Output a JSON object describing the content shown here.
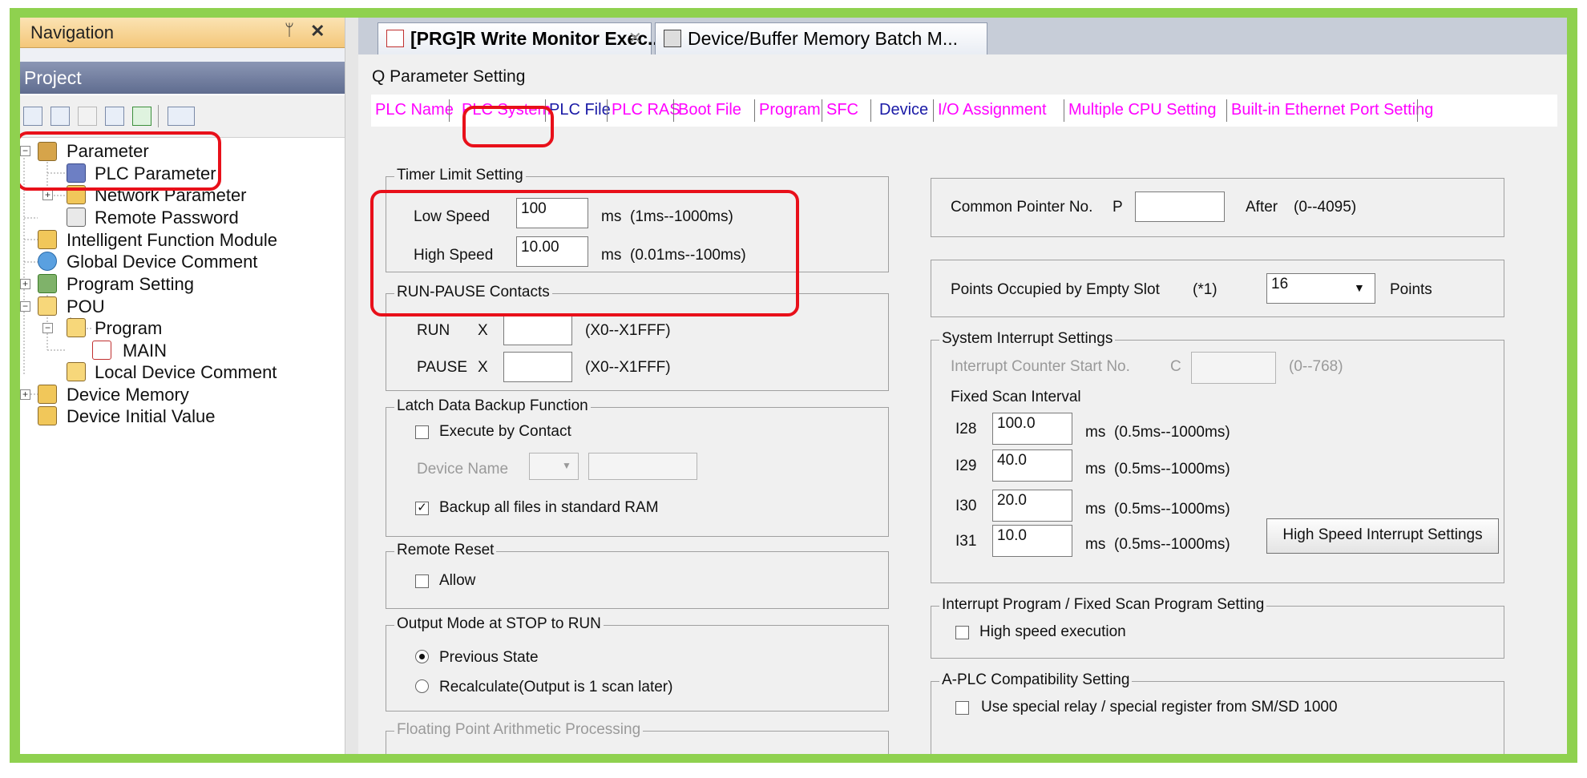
{
  "nav": {
    "title": "Navigation",
    "pin": "ᛘ",
    "close": "✕",
    "project_title": "Project",
    "tree": [
      {
        "label": "Parameter"
      },
      {
        "label": "PLC Parameter"
      },
      {
        "label": "Network Parameter"
      },
      {
        "label": "Remote Password"
      },
      {
        "label": "Intelligent Function Module"
      },
      {
        "label": "Global Device Comment"
      },
      {
        "label": "Program Setting"
      },
      {
        "label": "POU"
      },
      {
        "label": "Program"
      },
      {
        "label": "MAIN"
      },
      {
        "label": "Local Device Comment"
      },
      {
        "label": "Device Memory"
      },
      {
        "label": "Device Initial Value"
      }
    ]
  },
  "doc_tabs": [
    {
      "label": "[PRG]R Write Monitor Exec...",
      "close": "✕"
    },
    {
      "label": "Device/Buffer Memory Batch M..."
    }
  ],
  "dialog_title": "Q Parameter Setting",
  "param_tabs": [
    "PLC Name",
    "PLC System",
    "PLC File",
    "PLC RAS",
    "Boot File",
    "Program",
    "SFC",
    "Device",
    "I/O Assignment",
    "Multiple CPU Setting",
    "Built-in Ethernet Port Setting"
  ],
  "timer": {
    "title": "Timer Limit Setting",
    "low_label": "Low Speed",
    "low_value": "100",
    "low_unit": "ms",
    "low_range": "(1ms--1000ms)",
    "high_label": "High Speed",
    "high_value": "10.00",
    "high_unit": "ms",
    "high_range": "(0.01ms--100ms)"
  },
  "run_pause": {
    "title": "RUN-PAUSE Contacts",
    "run_label": "RUN",
    "pause_label": "PAUSE",
    "x": "X",
    "run_range": "(X0--X1FFF)",
    "pause_range": "(X0--X1FFF)"
  },
  "latch": {
    "title": "Latch Data Backup Function",
    "execute": "Execute by Contact",
    "device_name": "Device Name",
    "backup": "Backup all files in standard RAM"
  },
  "remote_reset": {
    "title": "Remote Reset",
    "allow": "Allow"
  },
  "output_mode": {
    "title": "Output Mode at STOP to RUN",
    "prev": "Previous State",
    "recalc": "Recalculate(Output is 1 scan later)"
  },
  "floating": {
    "title": "Floating Point Arithmetic Processing"
  },
  "common_pointer": {
    "label": "Common Pointer No.",
    "p": "P",
    "after": "After",
    "range": "(0--4095)"
  },
  "empty_slot": {
    "label": "Points Occupied by Empty Slot",
    "note": "(*1)",
    "value": "16",
    "unit": "Points"
  },
  "sys_interrupt": {
    "title": "System Interrupt Settings",
    "counter_label": "Interrupt Counter Start No.",
    "counter_c": "C",
    "counter_range": "(0--768)",
    "fixed_scan": "Fixed Scan Interval",
    "rows": [
      {
        "name": "I28",
        "value": "100.0",
        "unit": "ms",
        "range": "(0.5ms--1000ms)"
      },
      {
        "name": "I29",
        "value": "40.0",
        "unit": "ms",
        "range": "(0.5ms--1000ms)"
      },
      {
        "name": "I30",
        "value": "20.0",
        "unit": "ms",
        "range": "(0.5ms--1000ms)"
      },
      {
        "name": "I31",
        "value": "10.0",
        "unit": "ms",
        "range": "(0.5ms--1000ms)"
      }
    ],
    "hs_button": "High Speed Interrupt Settings"
  },
  "interrupt_program": {
    "title": "Interrupt Program / Fixed Scan Program Setting",
    "high_speed": "High speed execution"
  },
  "aplc": {
    "title": "A-PLC Compatibility Setting",
    "use_special": "Use special relay / special register from SM/SD 1000"
  },
  "colors": {
    "highlight": "#e8101a",
    "frame": "#8fd14f",
    "tab_magenta": "#ff00ff",
    "tab_blue": "#1a1aa6"
  }
}
